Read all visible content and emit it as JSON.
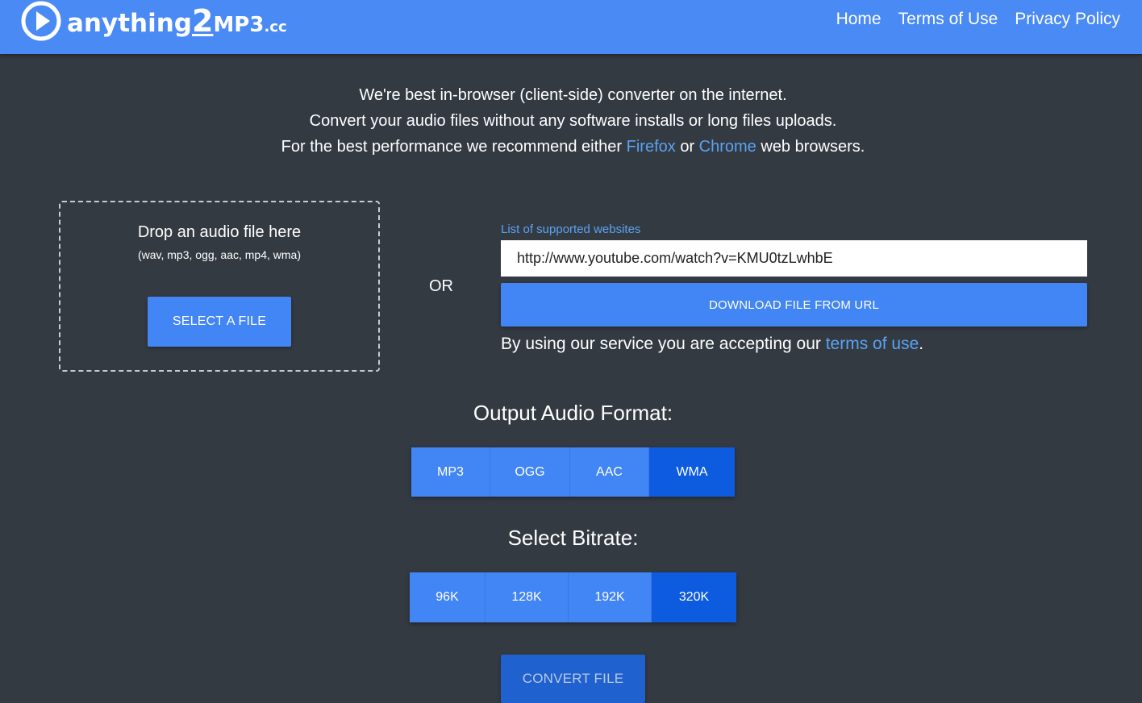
{
  "header": {
    "logo": {
      "part1": "anything",
      "part2": "2",
      "part3": "MP3",
      "part4": ".cc"
    },
    "nav": [
      "Home",
      "Terms of Use",
      "Privacy Policy"
    ]
  },
  "intro": {
    "line1": "We're best in-browser (client-side) converter on the internet.",
    "line2": "Convert your audio files without any software installs or long files uploads.",
    "line3_prefix": "For the best performance we recommend either ",
    "firefox": "Firefox",
    "line3_or": " or ",
    "chrome": "Chrome",
    "line3_suffix": " web browsers."
  },
  "dropzone": {
    "title": "Drop an audio file here",
    "formats": "(wav, mp3, ogg, aac, mp4, wma)",
    "select_button": "SELECT A FILE"
  },
  "or_label": "OR",
  "url_panel": {
    "supported_link": "List of supported websites",
    "url_value": "http://www.youtube.com/watch?v=KMU0tzLwhbE",
    "download_button": "DOWNLOAD FILE FROM URL",
    "accept_prefix": "By using our service you are accepting our ",
    "terms_link": "terms of use",
    "accept_suffix": "."
  },
  "output_format": {
    "title": "Output Audio Format:",
    "options": [
      "MP3",
      "OGG",
      "AAC",
      "WMA"
    ],
    "selected": "WMA"
  },
  "bitrate": {
    "title": "Select Bitrate:",
    "options": [
      "96K",
      "128K",
      "192K",
      "320K"
    ],
    "selected": "320K"
  },
  "convert_button": "CONVERT FILE",
  "colors": {
    "header_bg": "#4a8af4",
    "page_bg": "#343a42",
    "button": "#4285f4",
    "button_active": "#0d5ce0",
    "link": "#5aa3f2"
  }
}
